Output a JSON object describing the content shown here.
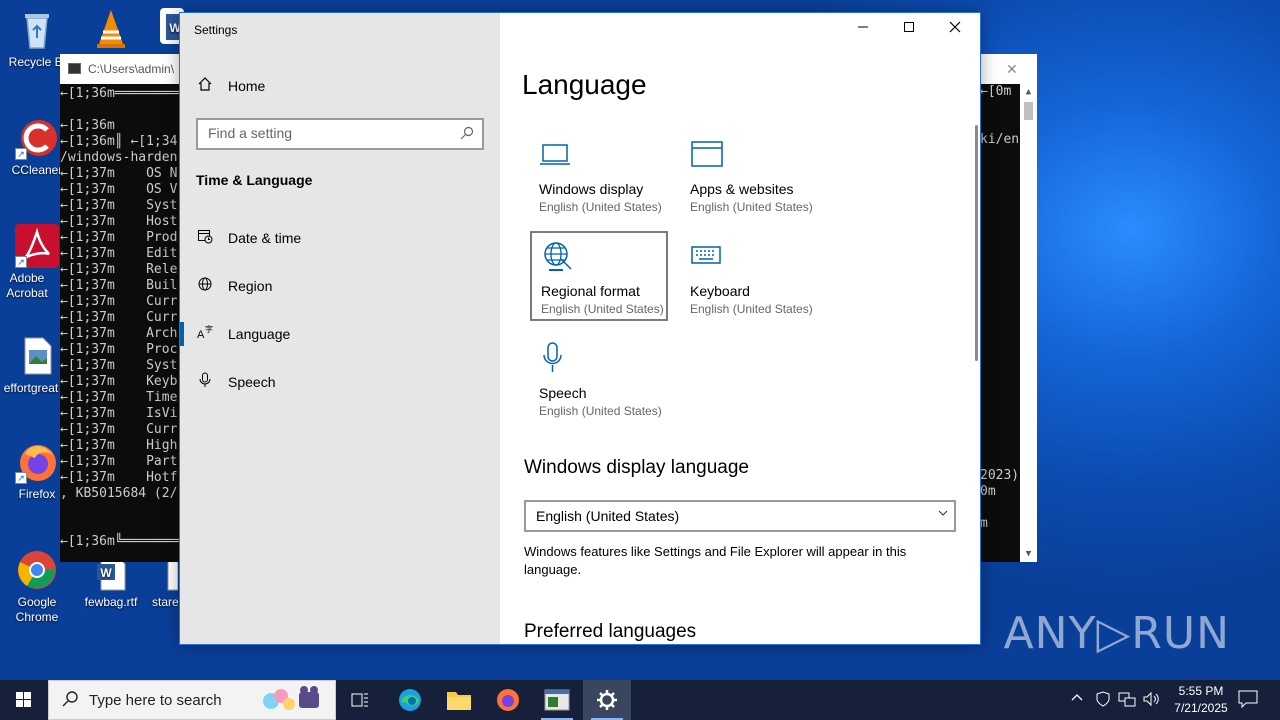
{
  "desktop": {
    "icons": [
      {
        "label": "Recycle Bi",
        "name": "recycle-bin"
      },
      {
        "label": "CCleaner",
        "name": "ccleaner"
      },
      {
        "label": "Adobe Acrobat",
        "name": "adobe-acrobat"
      },
      {
        "label": "effortgreat",
        "name": "effortgreat"
      },
      {
        "label": "Firefox",
        "name": "firefox"
      },
      {
        "label": "Google Chrome",
        "name": "google-chrome"
      },
      {
        "label": "fewbag.rtf",
        "name": "fewbag-rtf"
      },
      {
        "label": "stare",
        "name": "stare"
      }
    ]
  },
  "console": {
    "title": "C:\\Users\\admin\\",
    "lines": [
      "←[1;36m═════════════",
      "",
      "←[1;36m",
      "←[1;36m║ ←[1;34",
      "/windows-harden",
      "←[1;37m    OS N",
      "←[1;37m    OS V",
      "←[1;37m    Syst",
      "←[1;37m    Host",
      "←[1;37m    Prod",
      "←[1;37m    Edit",
      "←[1;37m    Rele",
      "←[1;37m    Buil",
      "←[1;37m    Curr",
      "←[1;37m    Curr",
      "←[1;37m    Arch",
      "←[1;37m    Proc",
      "←[1;37m    Syst",
      "←[1;37m    Keyb",
      "←[1;37m    Time",
      "←[1;37m    IsVi",
      "←[1;37m    Curr",
      "←[1;37m    High",
      "←[1;37m    Part",
      "←[1;37m    Hotf",
      ", KB5015684 (2/",
      "",
      "",
      "←[1;36m╚════════════"
    ],
    "right_lines": [
      "←[0m",
      "",
      "",
      "ki/en",
      "",
      "",
      "",
      "",
      "",
      "",
      "",
      "",
      "",
      "",
      "",
      "",
      "",
      "",
      "",
      "",
      "",
      "",
      "",
      "",
      "2023)",
      "0m",
      "",
      "m"
    ]
  },
  "settings": {
    "window_title": "Settings",
    "controls": {
      "minimize": "—",
      "maximize": "☐",
      "close": "✕"
    },
    "sidebar": {
      "home": "Home",
      "search_placeholder": "Find a setting",
      "section": "Time & Language",
      "items": [
        {
          "label": "Date & time",
          "icon": "calendar-clock-icon"
        },
        {
          "label": "Region",
          "icon": "globe-icon"
        },
        {
          "label": "Language",
          "icon": "language-icon",
          "active": true
        },
        {
          "label": "Speech",
          "icon": "microphone-icon"
        }
      ]
    },
    "main": {
      "title": "Language",
      "tiles": [
        {
          "name": "Windows display",
          "sub": "English (United States)",
          "icon": "laptop-icon"
        },
        {
          "name": "Apps & websites",
          "sub": "English (United States)",
          "icon": "browser-window-icon"
        },
        {
          "name": "Regional format",
          "sub": "English (United States)",
          "icon": "globe-region-icon"
        },
        {
          "name": "Keyboard",
          "sub": "English (United States)",
          "icon": "keyboard-icon"
        },
        {
          "name": "Speech",
          "sub": "English (United States)",
          "icon": "microphone-icon"
        }
      ],
      "display_language_heading": "Windows display language",
      "display_language_value": "English (United States)",
      "display_language_desc": "Windows features like Settings and File Explorer will appear in this language.",
      "preferred_heading": "Preferred languages"
    }
  },
  "taskbar": {
    "search_placeholder": "Type here to search",
    "time": "5:55 PM",
    "date": "7/21/2025",
    "apps": [
      "task-view",
      "edge",
      "file-explorer",
      "firefox",
      "app-window",
      "settings"
    ]
  },
  "watermark": "ANY▷RUN",
  "colors": {
    "accent": "#0063b1",
    "sidebar_bg": "#e6e6e6",
    "taskbar": "#16203a"
  }
}
